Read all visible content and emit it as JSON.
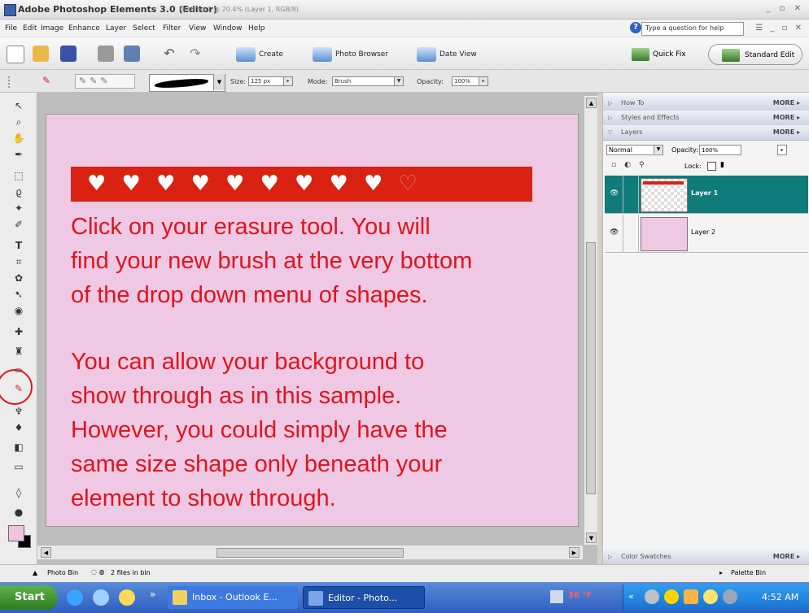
{
  "window": {
    "title": "Adobe Photoshop Elements 3.0 (Editor)",
    "document": "Untitled-1 @ 20.4% (Layer 1, RGB/8)",
    "controls": "_ ▫ ✕"
  },
  "menu": {
    "items": [
      "File",
      "Edit",
      "Image",
      "Enhance",
      "Layer",
      "Select",
      "Filter",
      "View",
      "Window",
      "Help"
    ],
    "help_placeholder": "Type a question for help",
    "right_controls": "☰ _ ▫ ✕"
  },
  "shortcuts": {
    "create": "Create",
    "photo_browser": "Photo Browser",
    "date_view": "Date View",
    "quick_fix": "Quick Fix",
    "standard_edit": "Standard Edit"
  },
  "options": {
    "size_label": "Size:",
    "size_value": "125 px",
    "mode_label": "Mode:",
    "mode_value": "Brush",
    "opacity_label": "Opacity:",
    "opacity_value": "100%"
  },
  "canvas": {
    "hearts_filled": 9,
    "hearts_outline": 1,
    "paragraph1": [
      "Click on your erasure tool.  You will",
      "find your new brush at the very bottom",
      "of the drop down menu of shapes."
    ],
    "paragraph2": [
      "You can allow your background to",
      "show through as in this sample.",
      "However, you could simply have the",
      "same size shape only beneath your",
      "element to show through."
    ],
    "background_color": "#efc9e3",
    "text_color": "#e0141e",
    "strip_color": "#d92212"
  },
  "palette": {
    "how_to": "How To",
    "styles": "Styles and Effects",
    "layers": "Layers",
    "more": "MORE",
    "blend_mode": "Normal",
    "opacity_label": "Opacity:",
    "opacity_value": "100%",
    "lock_label": "Lock:",
    "layer1": "Layer 1",
    "layer2": "Layer 2",
    "color_swatches": "Color Swatches"
  },
  "status": {
    "photo_bin": "Photo Bin",
    "files_in_bin": "2 files in bin",
    "palette_bin": "Palette Bin"
  },
  "taskbar": {
    "start": "Start",
    "overflow": "»",
    "task1": "Inbox - Outlook E...",
    "task2": "Editor - Photo...",
    "temperature": "36 °F",
    "tray_overflow": "«",
    "time": "4:52 AM"
  }
}
